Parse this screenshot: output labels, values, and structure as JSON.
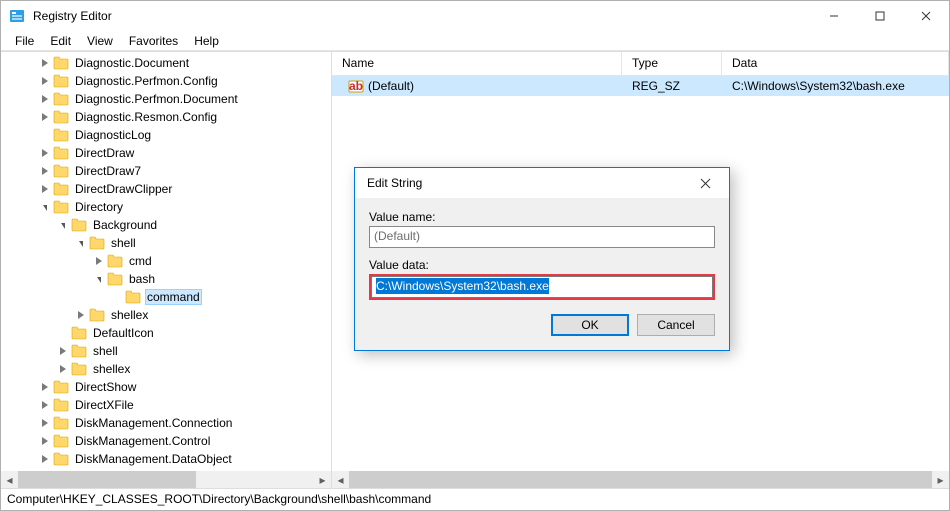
{
  "window": {
    "title": "Registry Editor"
  },
  "menubar": {
    "items": [
      "File",
      "Edit",
      "View",
      "Favorites",
      "Help"
    ]
  },
  "tree": {
    "nodes": [
      {
        "indent": 2,
        "twisty": "closed",
        "label": "Diagnostic.Document"
      },
      {
        "indent": 2,
        "twisty": "closed",
        "label": "Diagnostic.Perfmon.Config"
      },
      {
        "indent": 2,
        "twisty": "closed",
        "label": "Diagnostic.Perfmon.Document"
      },
      {
        "indent": 2,
        "twisty": "closed",
        "label": "Diagnostic.Resmon.Config"
      },
      {
        "indent": 2,
        "twisty": "none",
        "label": "DiagnosticLog"
      },
      {
        "indent": 2,
        "twisty": "closed",
        "label": "DirectDraw"
      },
      {
        "indent": 2,
        "twisty": "closed",
        "label": "DirectDraw7"
      },
      {
        "indent": 2,
        "twisty": "closed",
        "label": "DirectDrawClipper"
      },
      {
        "indent": 2,
        "twisty": "open",
        "label": "Directory"
      },
      {
        "indent": 3,
        "twisty": "open",
        "label": "Background"
      },
      {
        "indent": 4,
        "twisty": "open",
        "label": "shell"
      },
      {
        "indent": 5,
        "twisty": "closed",
        "label": "cmd"
      },
      {
        "indent": 5,
        "twisty": "open",
        "label": "bash"
      },
      {
        "indent": 6,
        "twisty": "none",
        "label": "command",
        "selected": true
      },
      {
        "indent": 4,
        "twisty": "closed",
        "label": "shellex"
      },
      {
        "indent": 3,
        "twisty": "none",
        "label": "DefaultIcon"
      },
      {
        "indent": 3,
        "twisty": "closed",
        "label": "shell"
      },
      {
        "indent": 3,
        "twisty": "closed",
        "label": "shellex"
      },
      {
        "indent": 2,
        "twisty": "closed",
        "label": "DirectShow"
      },
      {
        "indent": 2,
        "twisty": "closed",
        "label": "DirectXFile"
      },
      {
        "indent": 2,
        "twisty": "closed",
        "label": "DiskManagement.Connection"
      },
      {
        "indent": 2,
        "twisty": "closed",
        "label": "DiskManagement.Control"
      },
      {
        "indent": 2,
        "twisty": "closed",
        "label": "DiskManagement.DataObject"
      }
    ]
  },
  "list": {
    "columns": {
      "name": "Name",
      "type": "Type",
      "data": "Data"
    },
    "rows": [
      {
        "name": "(Default)",
        "type": "REG_SZ",
        "data": "C:\\Windows\\System32\\bash.exe",
        "selected": true
      }
    ]
  },
  "statusbar": {
    "path": "Computer\\HKEY_CLASSES_ROOT\\Directory\\Background\\shell\\bash\\command"
  },
  "dialog": {
    "title": "Edit String",
    "value_name_label": "Value name:",
    "value_name": "(Default)",
    "value_data_label": "Value data:",
    "value_data": "C:\\Windows\\System32\\bash.exe",
    "ok": "OK",
    "cancel": "Cancel"
  }
}
